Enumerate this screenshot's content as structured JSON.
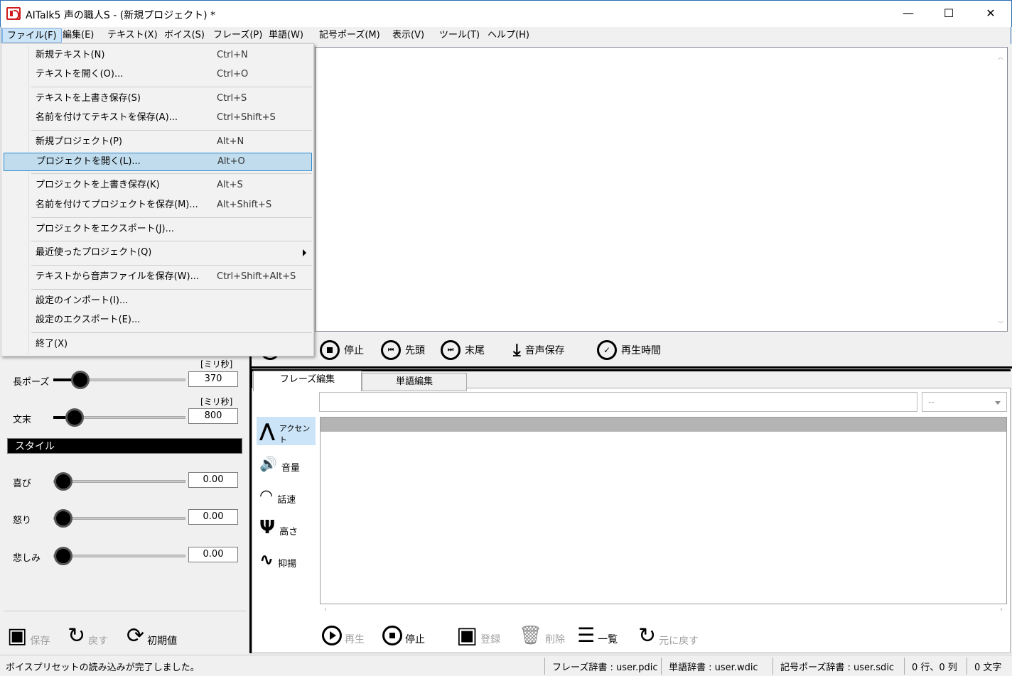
{
  "window": {
    "title": "AITalk5 声の職人S - (新規プロジェクト) *",
    "minimize": "—",
    "maximize": "☐",
    "close": "✕"
  },
  "menubar": [
    "ファイル(F)",
    "編集(E)",
    "テキスト(X)",
    "ボイス(S)",
    "フレーズ(P)",
    "単語(W)",
    "記号ポーズ(M)",
    "表示(V)",
    "ツール(T)",
    "ヘルプ(H)"
  ],
  "file_menu": [
    {
      "label": "新規テキスト(N)",
      "shortcut": "Ctrl+N"
    },
    {
      "label": "テキストを開く(O)...",
      "shortcut": "Ctrl+O"
    },
    {
      "label": "テキストを上書き保存(S)",
      "shortcut": "Ctrl+S"
    },
    {
      "label": "名前を付けてテキストを保存(A)...",
      "shortcut": "Ctrl+Shift+S"
    },
    {
      "label": "新規プロジェクト(P)",
      "shortcut": "Alt+N"
    },
    {
      "label": "プロジェクトを開く(L)...",
      "shortcut": "Alt+O"
    },
    {
      "label": "プロジェクトを上書き保存(K)",
      "shortcut": "Alt+S"
    },
    {
      "label": "名前を付けてプロジェクトを保存(M)...",
      "shortcut": "Alt+Shift+S"
    },
    {
      "label": "プロジェクトをエクスポート(J)...",
      "shortcut": ""
    },
    {
      "label": "最近使ったプロジェクト(Q)",
      "shortcut": ""
    },
    {
      "label": "テキストから音声ファイルを保存(W)...",
      "shortcut": "Ctrl+Shift+Alt+S"
    },
    {
      "label": "設定のインポート(I)...",
      "shortcut": ""
    },
    {
      "label": "設定のエクスポート(E)...",
      "shortcut": ""
    },
    {
      "label": "終了(X)",
      "shortcut": ""
    }
  ],
  "playbar": {
    "play": "再生",
    "stop": "停止",
    "start": "先頭",
    "end": "末尾",
    "save_audio": "音声保存",
    "play_time": "再生時間"
  },
  "pause": {
    "unit": "[ミリ秒]",
    "long_label": "長ポーズ",
    "long_value": "370",
    "long_pos": 0.15,
    "end_label": "文末",
    "end_value": "800",
    "end_pos": 0.1
  },
  "style": {
    "header": "スタイル",
    "items": [
      {
        "label": "喜び",
        "value": "0.00",
        "pos": 0.0
      },
      {
        "label": "怒り",
        "value": "0.00",
        "pos": 0.0
      },
      {
        "label": "悲しみ",
        "value": "0.00",
        "pos": 0.0
      }
    ]
  },
  "preset_buttons": {
    "save": "保存",
    "back": "戻す",
    "default": "初期値"
  },
  "tabs": {
    "phrase": "フレーズ編集",
    "word": "単語編集"
  },
  "phrase_select": "--",
  "side_tools": {
    "accent": "アクセント",
    "volume": "音量",
    "speed": "話速",
    "pitch": "高さ",
    "intonation": "抑揚"
  },
  "phrase_buttons": {
    "play": "再生",
    "stop": "停止",
    "register": "登録",
    "delete": "削除",
    "list": "一覧",
    "undo": "元に戻す"
  },
  "status": {
    "message": "ボイスプリセットの読み込みが完了しました。",
    "phrase_dict": "フレーズ辞書 : user.pdic",
    "word_dict": "単語辞書 : user.wdic",
    "pause_dict": "記号ポーズ辞書 : user.sdic",
    "position": "0 行、0 列",
    "chars": "0 文字"
  }
}
